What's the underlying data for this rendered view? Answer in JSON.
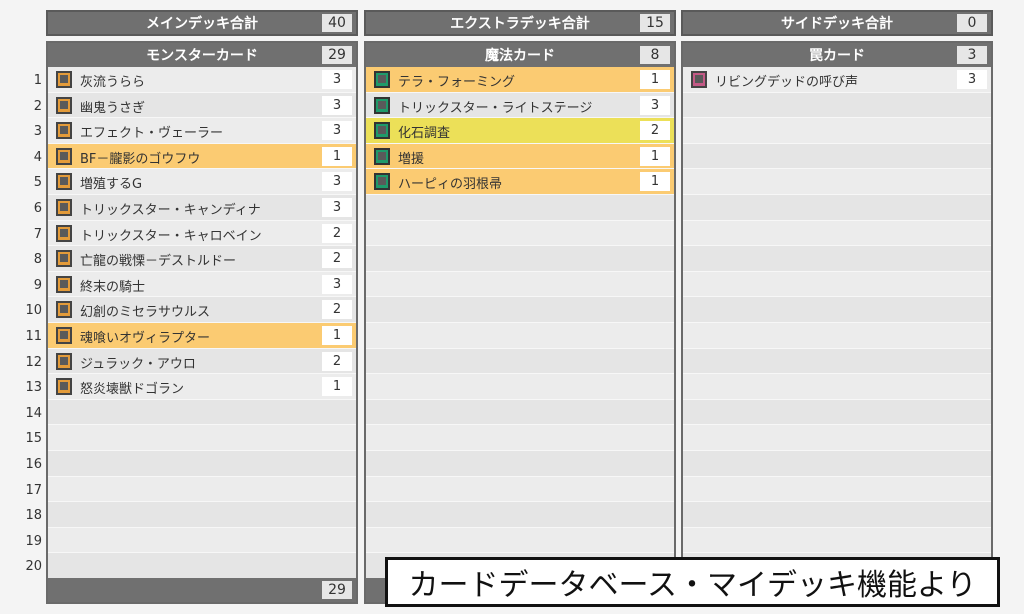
{
  "totals": {
    "main": {
      "label": "メインデッキ合計",
      "value": "40"
    },
    "extra": {
      "label": "エクストラデッキ合計",
      "value": "15"
    },
    "side": {
      "label": "サイドデッキ合計",
      "value": "0"
    }
  },
  "monster": {
    "label": "モンスターカード",
    "count": "29",
    "footer_count": "29",
    "cards": [
      {
        "name": "灰流うらら",
        "count": "3",
        "highlight": ""
      },
      {
        "name": "幽鬼うさぎ",
        "count": "3",
        "highlight": ""
      },
      {
        "name": "エフェクト・ヴェーラー",
        "count": "3",
        "highlight": ""
      },
      {
        "name": "BF－朧影のゴウフウ",
        "count": "1",
        "highlight": "orange"
      },
      {
        "name": "増殖するG",
        "count": "3",
        "highlight": ""
      },
      {
        "name": "トリックスター・キャンディナ",
        "count": "3",
        "highlight": ""
      },
      {
        "name": "トリックスター・キャロベイン",
        "count": "2",
        "highlight": ""
      },
      {
        "name": "亡龍の戦慄－デストルドー",
        "count": "2",
        "highlight": ""
      },
      {
        "name": "終末の騎士",
        "count": "3",
        "highlight": ""
      },
      {
        "name": "幻創のミセラサウルス",
        "count": "2",
        "highlight": ""
      },
      {
        "name": "魂喰いオヴィラプター",
        "count": "1",
        "highlight": "orange"
      },
      {
        "name": "ジュラック・アウロ",
        "count": "2",
        "highlight": ""
      },
      {
        "name": "怒炎壊獣ドゴラン",
        "count": "1",
        "highlight": ""
      }
    ]
  },
  "spell": {
    "label": "魔法カード",
    "count": "8",
    "cards": [
      {
        "name": "テラ・フォーミング",
        "count": "1",
        "highlight": "orange"
      },
      {
        "name": "トリックスター・ライトステージ",
        "count": "3",
        "highlight": ""
      },
      {
        "name": "化石調査",
        "count": "2",
        "highlight": "yellow"
      },
      {
        "name": "増援",
        "count": "1",
        "highlight": "orange"
      },
      {
        "name": "ハーピィの羽根帚",
        "count": "1",
        "highlight": "orange"
      }
    ]
  },
  "trap": {
    "label": "罠カード",
    "count": "3",
    "cards": [
      {
        "name": "リビングデッドの呼び声",
        "count": "3",
        "highlight": ""
      }
    ]
  },
  "row_numbers": [
    "1",
    "2",
    "3",
    "4",
    "5",
    "6",
    "7",
    "8",
    "9",
    "10",
    "11",
    "12",
    "13",
    "14",
    "15",
    "16",
    "17",
    "18",
    "19",
    "20"
  ],
  "caption": "カードデータベース・マイデッキ機能より",
  "colors": {
    "header_bg": "#707070",
    "highlight_orange": "#fbcb72",
    "highlight_yellow": "#ece058",
    "monster_icon": "#e39b3a",
    "spell_icon": "#1f9a6a",
    "trap_icon": "#c45a86"
  }
}
